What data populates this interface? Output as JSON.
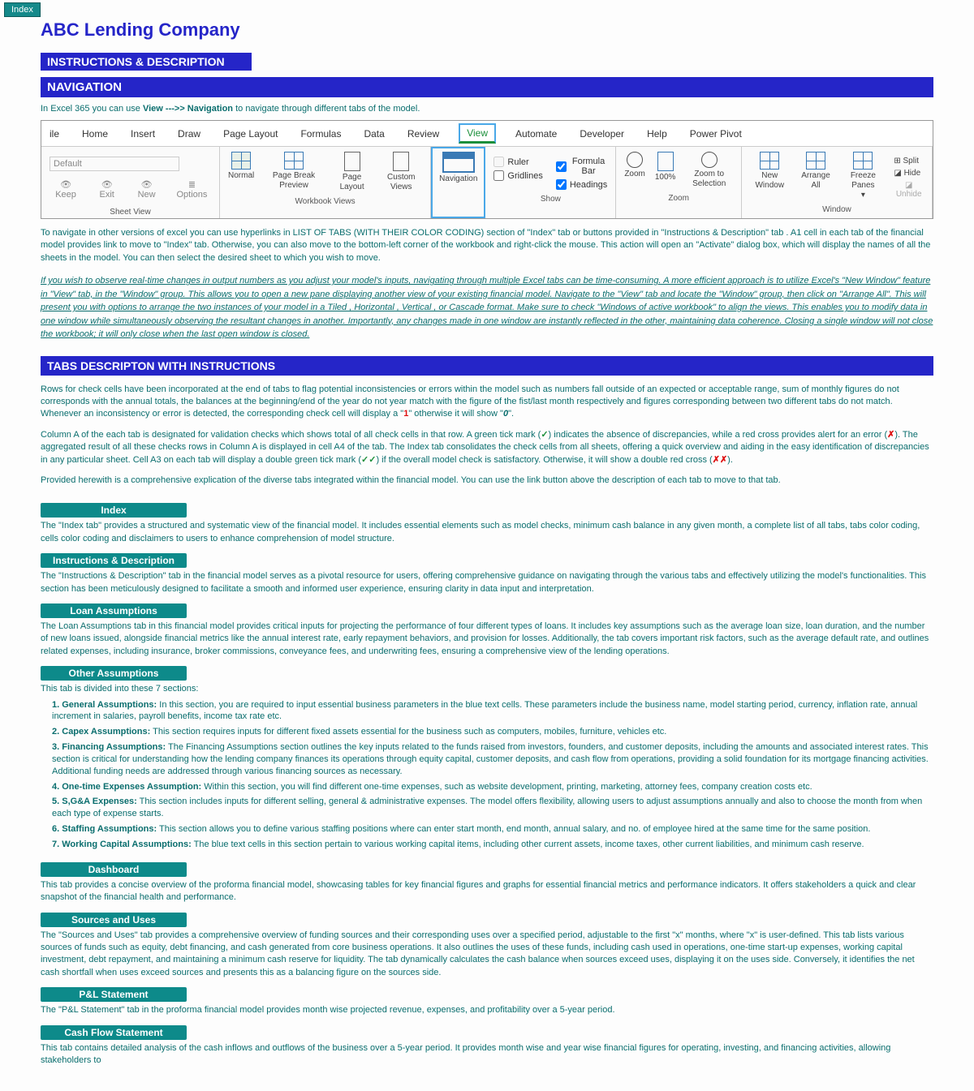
{
  "indexTab": "Index",
  "company": "ABC Lending Company",
  "bars": {
    "instructions": "INSTRUCTIONS & DESCRIPTION",
    "navigation": "NAVIGATION",
    "tabsDesc": "TABS DESCRIPTON WITH INSTRUCTIONS"
  },
  "navIntro": {
    "pre": "In Excel 365 you can use ",
    "view": "View",
    "arrow": "  --->> ",
    "navigation": "Navigation",
    "post": " to navigate through different tabs of the model."
  },
  "ribbon": {
    "tabs": [
      "ile",
      "Home",
      "Insert",
      "Draw",
      "Page Layout",
      "Formulas",
      "Data",
      "Review",
      "View",
      "Automate",
      "Developer",
      "Help",
      "Power Pivot"
    ],
    "groupSheetView": {
      "title": "Sheet View",
      "default": "Default",
      "keep": "Keep",
      "exit": "Exit",
      "new": "New",
      "options": "Options"
    },
    "groupWorkbook": {
      "title": "Workbook Views",
      "normal": "Normal",
      "pageBreak": "Page Break Preview",
      "pageLayout": "Page Layout",
      "custom": "Custom Views"
    },
    "navBtn": "Navigation",
    "groupShow": {
      "title": "Show",
      "ruler": "Ruler",
      "gridlines": "Gridlines",
      "formulaBar": "Formula Bar",
      "headings": "Headings"
    },
    "groupZoom": {
      "title": "Zoom",
      "zoom": "Zoom",
      "hundred": "100%",
      "zoomSel": "Zoom to Selection"
    },
    "groupWindow": {
      "title": "Window",
      "newWin": "New Window",
      "arrange": "Arrange All",
      "freeze": "Freeze Panes",
      "split": "Split",
      "hide": "Hide",
      "unhide": "Unhide"
    }
  },
  "paraNav": "To navigate in other versions of excel you can use hyperlinks in LIST OF TABS (WITH THEIR COLOR CODING) section of \"Index\" tab or buttons provided in \"Instructions & Description\" tab . A1 cell in each tab of the financial model provides link to move to \"Index\" tab. Otherwise, you can also move to the bottom-left corner of the workbook and right-click the mouse. This action will open an \"Activate\" dialog box, which will display the names of all the sheets in the model. You can then select the desired sheet to which you wish to move.",
  "italic": "If you wish to observe real-time changes in output numbers as you adjust your model's inputs, navigating through multiple Excel tabs can be time-consuming. A more efficient approach is to utilize Excel's \"New Window\" feature in \"View\" tab, in the \"Window\" group. This allows you to open a new pane displaying another view of your existing financial model. Navigate to the \"View\" tab and locate the \"Window\" group, then click on \"Arrange All\". This will present you with options to arrange the two instances of your model in a Tiled , Horizontal , Vertical , or Cascade  format. Make sure to check \"Windows of active workbook\" to align the views. This  enables you to modify data in one window while simultaneously observing the resultant changes in another. Importantly, any changes made in one window are instantly reflected in the other, maintaining data coherence. Closing a single window will not close the workbook; it will only close when the last open window is closed.",
  "checksP1a": "Rows for check cells have been incorporated at the end of tabs to flag potential inconsistencies or errors within the model such as numbers fall outside of an expected or acceptable range, sum of monthly figures do not corresponds with the annual totals, the balances at the beginning/end of the year do not year match with the figure of the fist/last month respectively and figures corresponding between two different tabs do not match. Whenever an inconsistency or error is detected, the corresponding check cell will display a \"",
  "checksP1b": "1",
  "checksP1c": "\" otherwise it will show \"",
  "checksP1d": "0",
  "checksP1e": "\".",
  "checksP2a": "Column A of the each tab is designated for validation checks which shows total of all check cells in that row. A green tick mark (",
  "tick": "✓",
  "checksP2b": ") indicates the absence of discrepancies, while a red cross provides alert for an error (",
  "cross": "✗",
  "checksP2c": "). The aggregated result of all these checks rows in Column A is displayed in cell A4 of the tab. The Index tab consolidates the check cells from all sheets, offering a quick overview and aiding in the easy identification of discrepancies in any particular sheet. Cell A3 on each tab will display a double green tick mark (",
  "dtick": "✓✓",
  "checksP2d": ") if the overall model check is satisfactory. Otherwise, it will show a double red cross (",
  "dcross": "✗✗",
  "checksP2e": ").",
  "checksP3": "Provided herewith is a comprehensive explication of the diverse tabs integrated within the financial model. You can use the link button above the description of each tab to move to that tab.",
  "tabs": {
    "index": {
      "title": "Index",
      "desc": "The \"Index tab\" provides a structured and systematic view of the financial model. It includes essential elements such as model checks, minimum cash balance in any given month, a complete list of all tabs, tabs color coding, cells color coding and disclaimers to users to enhance comprehension of model structure."
    },
    "instr": {
      "title": "Instructions & Description",
      "desc": "The \"Instructions & Description\" tab in the financial model serves as a pivotal resource for users, offering comprehensive guidance on navigating through the various tabs and effectively utilizing the model's functionalities. This section has been meticulously designed to facilitate a smooth and informed user experience, ensuring clarity in data input and interpretation."
    },
    "loan": {
      "title": "Loan Assumptions",
      "desc": "The Loan Assumptions tab in this financial model provides critical inputs for projecting the performance of four different types of loans. It includes key assumptions such as the average loan size, loan duration, and the number of new loans issued, alongside financial metrics like the annual interest rate, early repayment behaviors, and provision for losses. Additionally, the tab covers important risk factors, such as the average default rate, and outlines related expenses, including insurance, broker commissions, conveyance fees, and underwriting fees, ensuring a comprehensive view of the lending operations."
    },
    "other": {
      "title": "Other Assumptions",
      "intro": "This tab is divided into these 7 sections:",
      "s1": {
        "n": "1.",
        "l": "General Assumptions:",
        "t": " In this section, you are required to input essential business parameters in the blue text cells. These parameters include the business name, model starting period, currency, inflation rate, annual increment in salaries, payroll benefits, income tax rate etc."
      },
      "s2": {
        "n": "2.",
        "l": "Capex Assumptions:",
        "t": " This section requires inputs for different fixed assets essential for the business such as computers, mobiles, furniture, vehicles etc."
      },
      "s3": {
        "n": "3.",
        "l": "Financing Assumptions:",
        "t": " The Financing Assumptions section outlines the key inputs related to the funds raised from investors, founders, and customer deposits, including the amounts and associated interest rates. This section is critical  for understanding how the lending company finances its operations through equity capital, customer deposits, and cash flow from operations, providing a solid foundation for its mortgage financing activities. Additional funding needs are addressed through various financing sources as necessary."
      },
      "s4": {
        "n": "4.",
        "l": "One-time Expenses Assumption:",
        "t": " Within this section, you will find different one-time expenses, such as website development, printing, marketing, attorney fees, company creation costs etc."
      },
      "s5": {
        "n": "5.",
        "l": "S,G&A Expenses:",
        "t": " This section includes inputs for different selling,  general & administrative expenses. The model offers flexibility, allowing users to adjust assumptions annually and also to choose the month from when each type of expense starts."
      },
      "s6": {
        "n": "6.",
        "l": "Staffing Assumptions:",
        "t": " This section allows you to define various staffing positions where can enter start month, end month, annual salary, and no. of employee hired at  the same time for the same position."
      },
      "s7": {
        "n": "7.",
        "l": "Working Capital Assumptions:",
        "t": " The blue text cells in this section pertain to various working capital items, including other current assets, income taxes, other current liabilities, and minimum cash reserve."
      }
    },
    "dash": {
      "title": "Dashboard",
      "desc": "This tab provides a concise overview of the proforma financial model, showcasing tables for key financial figures and graphs for essential financial metrics and performance indicators. It offers stakeholders a quick and clear snapshot of the  financial health and performance."
    },
    "sources": {
      "title": "Sources and Uses",
      "desc": "The \"Sources and Uses\" tab provides a comprehensive overview of funding sources and their corresponding uses over a specified period, adjustable to the first \"x\" months, where \"x\" is user-defined. This tab lists various sources of funds such as equity, debt financing, and cash generated from core business operations. It also outlines the uses of these funds, including cash used in operations, one-time start-up expenses, working capital investment, debt repayment, and maintaining  a minimum cash reserve for liquidity. The tab dynamically calculates the cash balance when sources exceed uses, displaying it on the uses side. Conversely, it identifies the net cash shortfall when uses exceed sources and presents this as a balancing figure on the sources side."
    },
    "pl": {
      "title": "P&L Statement",
      "desc": "The \"P&L Statement\" tab in the proforma financial model provides month wise projected revenue, expenses, and profitability over a 5-year period."
    },
    "cf": {
      "title": "Cash Flow Statement",
      "desc": "This tab contains detailed analysis of the cash inflows and outflows of the business over a 5-year period. It provides month wise and year wise financial figures for operating, investing, and financing activities, allowing stakeholders to"
    }
  }
}
